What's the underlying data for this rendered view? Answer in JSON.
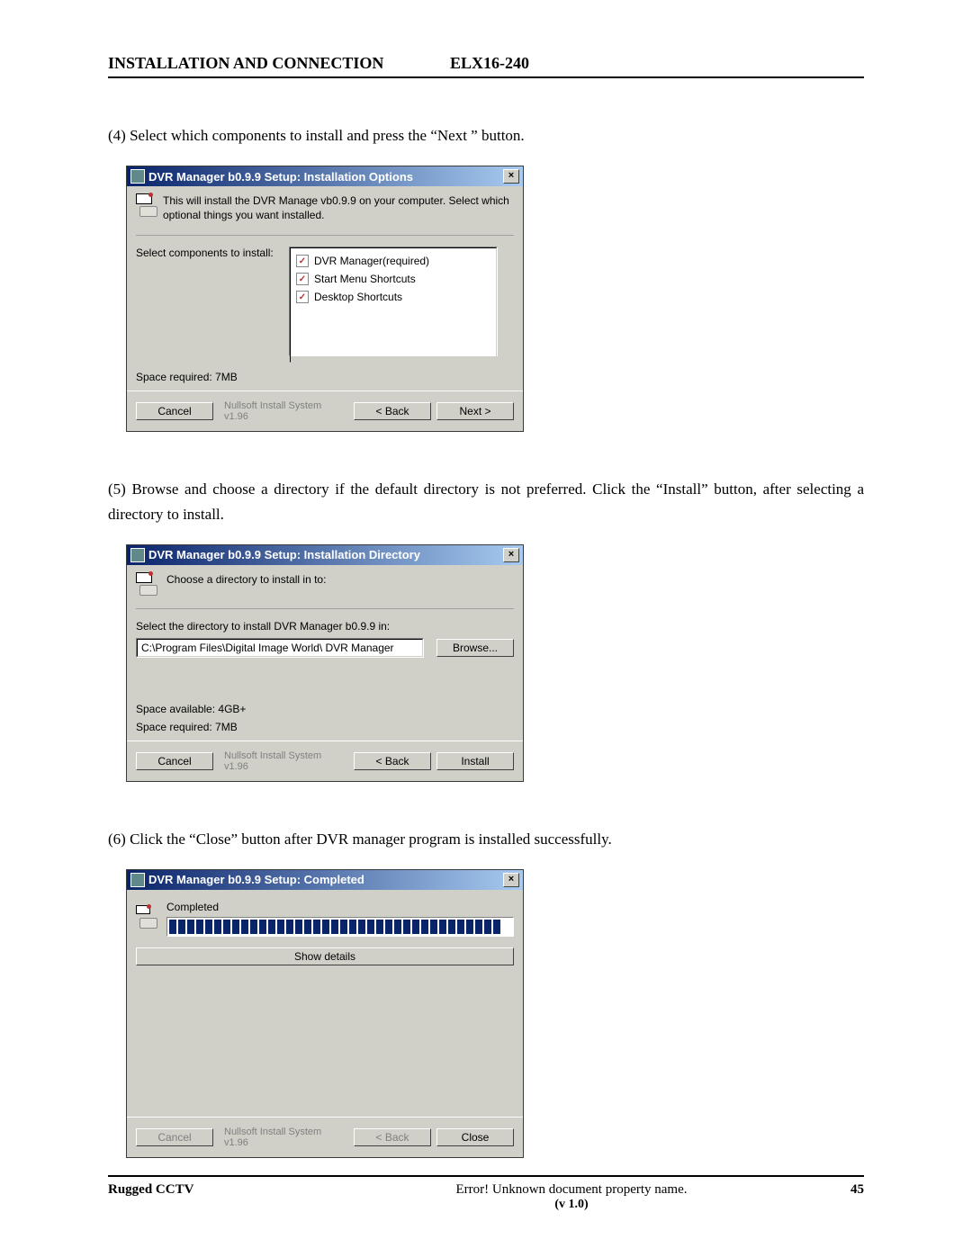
{
  "header": {
    "left": "INSTALLATION AND CONNECTION",
    "right": "ELX16-240"
  },
  "p4": "(4)  Select which components to install and press the  “Next ” button.",
  "dlg1": {
    "title": "DVR Manager b0.9.9 Setup: Installation Options",
    "top": "This will install the   DVR Manage vb0.9.9 on your computer. Select which optional things you want installed.",
    "sel": "Select components to install:",
    "item1": "DVR Manager(required)",
    "item2": "Start Menu Shortcuts",
    "item3": "Desktop Shortcuts",
    "space": "Space required: 7MB",
    "cancel": "Cancel",
    "sys": "Nullsoft Install System v1.96",
    "back": "< Back",
    "next": "Next >"
  },
  "p5": "(5)  Browse and choose a directory if the default directory is not preferred. Click the “Install” button, after selecting a directory to install.",
  "dlg2": {
    "title": "DVR Manager b0.9.9 Setup: Installation Directory",
    "top": "Choose a directory to install in to:",
    "sel": "Select the directory to install   DVR Manager b0.9.9 in:",
    "path": "C:\\Program Files\\Digital Image World\\  DVR Manager",
    "browse": "Browse...",
    "avail": "Space available: 4GB+",
    "space": "Space required: 7MB",
    "cancel": "Cancel",
    "sys": "Nullsoft Install System v1.96",
    "back": "< Back",
    "install": "Install"
  },
  "p6": "(6)  Click the “Close” button after DVR manager program is installed successfully.",
  "dlg3": {
    "title": "DVR Manager b0.9.9 Setup: Completed",
    "completed": "Completed",
    "show": "Show details",
    "cancel": "Cancel",
    "sys": "Nullsoft Install System v1.96",
    "back": "< Back",
    "close": "Close"
  },
  "footer": {
    "left": "Rugged CCTV",
    "center": "Error! Unknown document property name.",
    "ver": "(v 1.0)",
    "page": "45"
  }
}
